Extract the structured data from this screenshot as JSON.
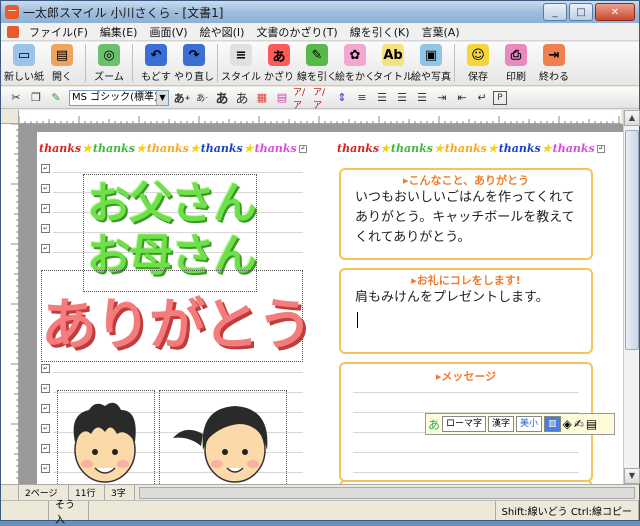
{
  "window": {
    "title": "一太郎スマイル 小川さくら - [文書1]",
    "controls": {
      "minimize": "_",
      "maximize": "□",
      "close": "✕"
    }
  },
  "menu": [
    "ファイル(F)",
    "編集(E)",
    "画面(V)",
    "絵や図(I)",
    "文書のかざり(T)",
    "線を引く(K)",
    "言葉(A)"
  ],
  "toolbar": [
    {
      "label": "新しい紙",
      "icon": "new-paper-icon",
      "glyph": "▭",
      "color": "#9ac4e8"
    },
    {
      "label": "開く",
      "icon": "open-icon",
      "glyph": "▤",
      "color": "#f0a35e"
    },
    {
      "label": "ズーム",
      "icon": "zoom-icon",
      "glyph": "◎",
      "color": "#6bc06b"
    },
    {
      "label": "もどす",
      "icon": "undo-icon",
      "glyph": "↶",
      "color": "#3b6fd6"
    },
    {
      "label": "やり直し",
      "icon": "redo-icon",
      "glyph": "↷",
      "color": "#3b6fd6"
    },
    {
      "label": "スタイル",
      "icon": "style-icon",
      "glyph": "≡",
      "color": "#e0e0e0"
    },
    {
      "label": "かざり",
      "icon": "decoration-icon",
      "glyph": "あ",
      "color": "#ff5a5a"
    },
    {
      "label": "線を引く",
      "icon": "draw-line-icon",
      "glyph": "✎",
      "color": "#56b94a"
    },
    {
      "label": "絵をかく",
      "icon": "paint-icon",
      "glyph": "✿",
      "color": "#f4a6d0"
    },
    {
      "label": "タイトル",
      "icon": "title-icon",
      "glyph": "Ab",
      "color": "#f7e27a"
    },
    {
      "label": "絵や写真",
      "icon": "picture-icon",
      "glyph": "▣",
      "color": "#8fc6e8"
    },
    {
      "label": "保存",
      "icon": "save-icon",
      "glyph": "☺",
      "color": "#f6d43a"
    },
    {
      "label": "印刷",
      "icon": "print-icon",
      "glyph": "⎙",
      "color": "#e88ac0"
    },
    {
      "label": "終わる",
      "icon": "exit-icon",
      "glyph": "⇥",
      "color": "#f08050"
    }
  ],
  "format_bar": {
    "font": "MS ゴシック(標準)"
  },
  "thanks_row": {
    "word": "thanks",
    "star": "★",
    "colors": [
      "#d82020",
      "#3cb83c",
      "#f5a623",
      "#1a3fcc",
      "#d84cd8"
    ]
  },
  "left_panel": {
    "green_line1": "お父さん",
    "green_line2": "お母さん",
    "red_text": "ありがとう"
  },
  "cards": [
    {
      "title": "こんなこと、ありがとう",
      "text": "いつもおいしいごはんを作ってくれてありがとう。キャッチボールを教えてくれてありがとう。"
    },
    {
      "title": "お礼にコレをします!",
      "text": "肩もみけんをプレゼントします。"
    },
    {
      "title": "メッセージ",
      "text": ""
    }
  ],
  "ime": {
    "mode1": "ローマ字",
    "mode2": "漢字",
    "mode3": "美小"
  },
  "status": {
    "page": "2ページ",
    "line": "11行",
    "char": "3字",
    "mode": "そう入",
    "hint": "Shift:線いどう Ctrl:線コピー"
  }
}
